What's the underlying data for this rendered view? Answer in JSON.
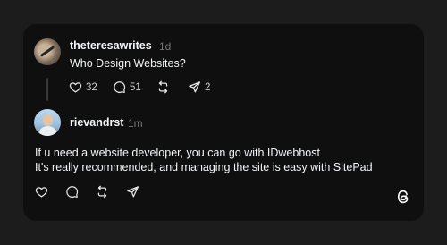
{
  "post": {
    "username": "theteresawrites",
    "time": "1d",
    "text": "Who Design Websites?",
    "likes": "32",
    "comments": "51",
    "reposts": "",
    "shares": "2"
  },
  "reply": {
    "username": "rievandrst",
    "time": "1m",
    "line1": "If u need a website developer, you can go with IDwebhost",
    "line2": "It's really recommended, and managing the site is easy with SitePad"
  },
  "icons": {
    "like": "heart-icon",
    "comment": "comment-bubble-icon",
    "repost": "repost-icon",
    "share": "send-icon",
    "brand": "threads-logo-icon"
  },
  "colors": {
    "background": "#1c1c1c",
    "card": "#0f0f0f",
    "text": "#f3f5f7",
    "muted": "#777777"
  }
}
